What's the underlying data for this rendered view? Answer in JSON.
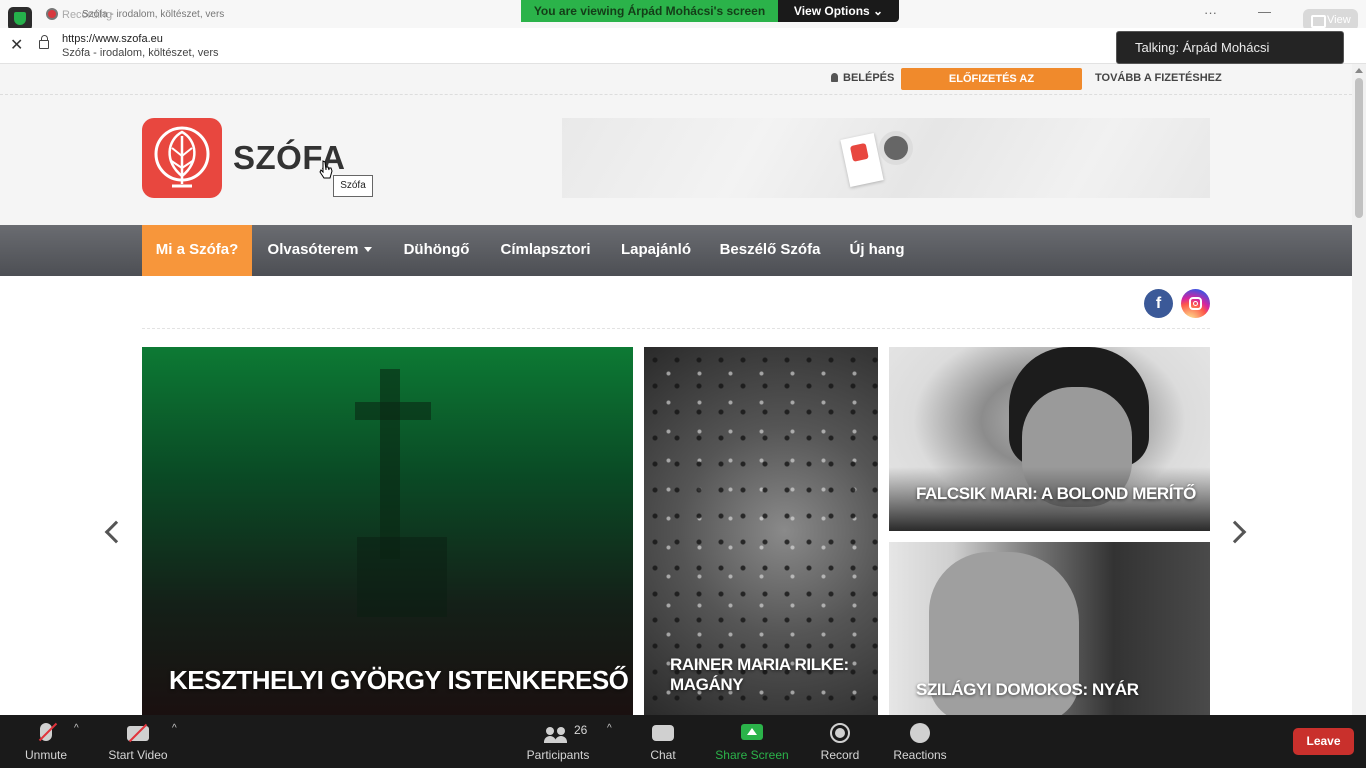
{
  "zoom": {
    "tab_title": "Szófa - irodalom, költészet, vers",
    "recording_label": "Recording",
    "viewing_banner": "You are viewing Árpád Mohácsi's screen",
    "view_options": "View Options ⌄",
    "view_button": "View",
    "more": "···",
    "minimize": "—",
    "talking": "Talking: Árpád Mohácsi"
  },
  "browser": {
    "url": "https://www.szofa.eu",
    "page_title": "Szófa - irodalom, költészet, vers"
  },
  "site": {
    "top_links": {
      "login": "BELÉPÉS",
      "subscribe": "ELŐFIZETÉS AZ OLVASÓTEREMRE",
      "checkout": "TOVÁBB A FIZETÉSHEZ"
    },
    "logo_text": "SZÓFA",
    "tooltip": "Szófa",
    "nav": [
      {
        "label": "Mi a Szófa?"
      },
      {
        "label": "Olvasóterem"
      },
      {
        "label": "Dühöngő"
      },
      {
        "label": "Címlapsztori"
      },
      {
        "label": "Lapajánló"
      },
      {
        "label": "Beszélő Szófa"
      },
      {
        "label": "Új hang"
      }
    ],
    "social": {
      "facebook": "f"
    },
    "cards": [
      {
        "title": "KESZTHELYI GYÖRGY ISTENKERESŐ"
      },
      {
        "title": "RAINER MARIA RILKE: MAGÁNY"
      },
      {
        "title": "FALCSIK MARI: A BOLOND MERÍTŐ"
      },
      {
        "title": "SZILÁGYI DOMOKOS: NYÁR"
      }
    ],
    "colors": {
      "accent": "#f7963b",
      "brand": "#e8473f",
      "nav": "#5a5c61"
    }
  },
  "toolbar": {
    "unmute": "Unmute",
    "start_video": "Start Video",
    "participants": "Participants",
    "participants_count": "26",
    "chat": "Chat",
    "share_screen": "Share Screen",
    "record": "Record",
    "reactions": "Reactions",
    "leave": "Leave",
    "caret": "^"
  }
}
